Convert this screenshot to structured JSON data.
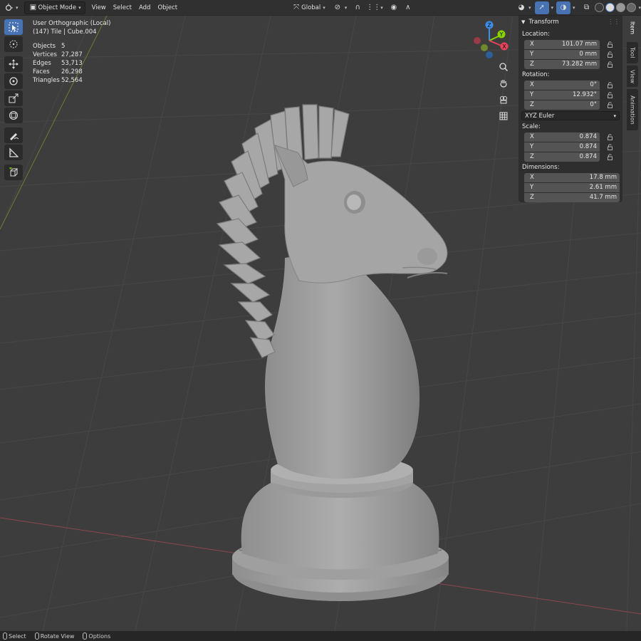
{
  "header": {
    "editor_icon": "viewport-icon",
    "mode": "Object Mode",
    "menus": [
      "View",
      "Select",
      "Add",
      "Object"
    ],
    "transform_orientation": "Global"
  },
  "viewport": {
    "view_name": "User Orthographic (Local)",
    "collection_info": "(147) Tile | Cube.004",
    "stats": [
      {
        "label": "Objects",
        "value": "5"
      },
      {
        "label": "Vertices",
        "value": "27,287"
      },
      {
        "label": "Edges",
        "value": "53,713"
      },
      {
        "label": "Faces",
        "value": "26,298"
      },
      {
        "label": "Triangles",
        "value": "52,564"
      }
    ],
    "gizmo": {
      "x": "X",
      "y": "Y",
      "z": "Z"
    }
  },
  "npanel": {
    "panel_title": "Transform",
    "location_label": "Location:",
    "location": [
      {
        "axis": "X",
        "value": "101.07 mm"
      },
      {
        "axis": "Y",
        "value": "0 mm"
      },
      {
        "axis": "Z",
        "value": "73.282 mm"
      }
    ],
    "rotation_label": "Rotation:",
    "rotation": [
      {
        "axis": "X",
        "value": "0°"
      },
      {
        "axis": "Y",
        "value": "12.932°"
      },
      {
        "axis": "Z",
        "value": "0°"
      }
    ],
    "rotation_mode": "XYZ Euler",
    "scale_label": "Scale:",
    "scale": [
      {
        "axis": "X",
        "value": "0.874"
      },
      {
        "axis": "Y",
        "value": "0.874"
      },
      {
        "axis": "Z",
        "value": "0.874"
      }
    ],
    "dimensions_label": "Dimensions:",
    "dimensions": [
      {
        "axis": "X",
        "value": "17.8 mm"
      },
      {
        "axis": "Y",
        "value": "2.61 mm"
      },
      {
        "axis": "Z",
        "value": "41.7 mm"
      }
    ]
  },
  "tabs": [
    "Item",
    "Tool",
    "View",
    "Animation"
  ],
  "statusbar": {
    "select": "Select",
    "rotate": "Rotate View",
    "options": "Options"
  },
  "colors": {
    "accent": "#4772b3",
    "axis_x": "#e8435a",
    "axis_y": "#8cd400",
    "axis_z": "#3b8fe8"
  }
}
